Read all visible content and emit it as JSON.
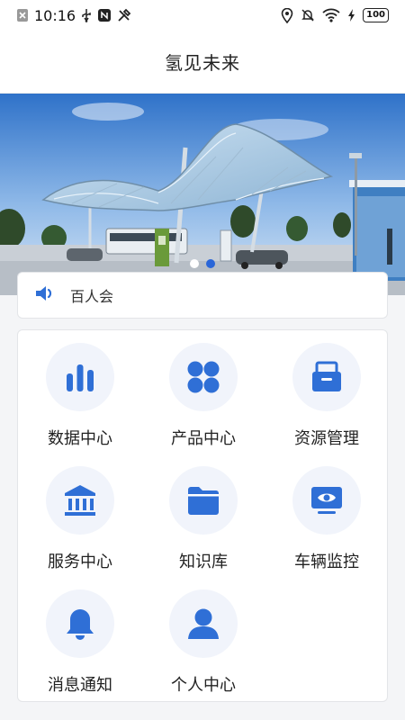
{
  "status_bar": {
    "time": "10:16",
    "battery": "100"
  },
  "app_bar": {
    "title": "氢见未来"
  },
  "banner": {
    "slide_count": 2,
    "active_slide": 2
  },
  "notice": {
    "text": "百人会",
    "icon": "speaker-icon"
  },
  "menu": {
    "items": [
      {
        "label": "数据中心",
        "icon": "bar-chart-icon"
      },
      {
        "label": "产品中心",
        "icon": "grid-icon"
      },
      {
        "label": "资源管理",
        "icon": "archive-icon"
      },
      {
        "label": "服务中心",
        "icon": "bank-icon"
      },
      {
        "label": "知识库",
        "icon": "folder-icon"
      },
      {
        "label": "车辆监控",
        "icon": "monitor-eye-icon"
      },
      {
        "label": "消息通知",
        "icon": "bell-icon"
      },
      {
        "label": "个人中心",
        "icon": "user-icon"
      }
    ]
  },
  "colors": {
    "accent": "#2f6fd6",
    "icon_bg": "#f1f4fb"
  }
}
